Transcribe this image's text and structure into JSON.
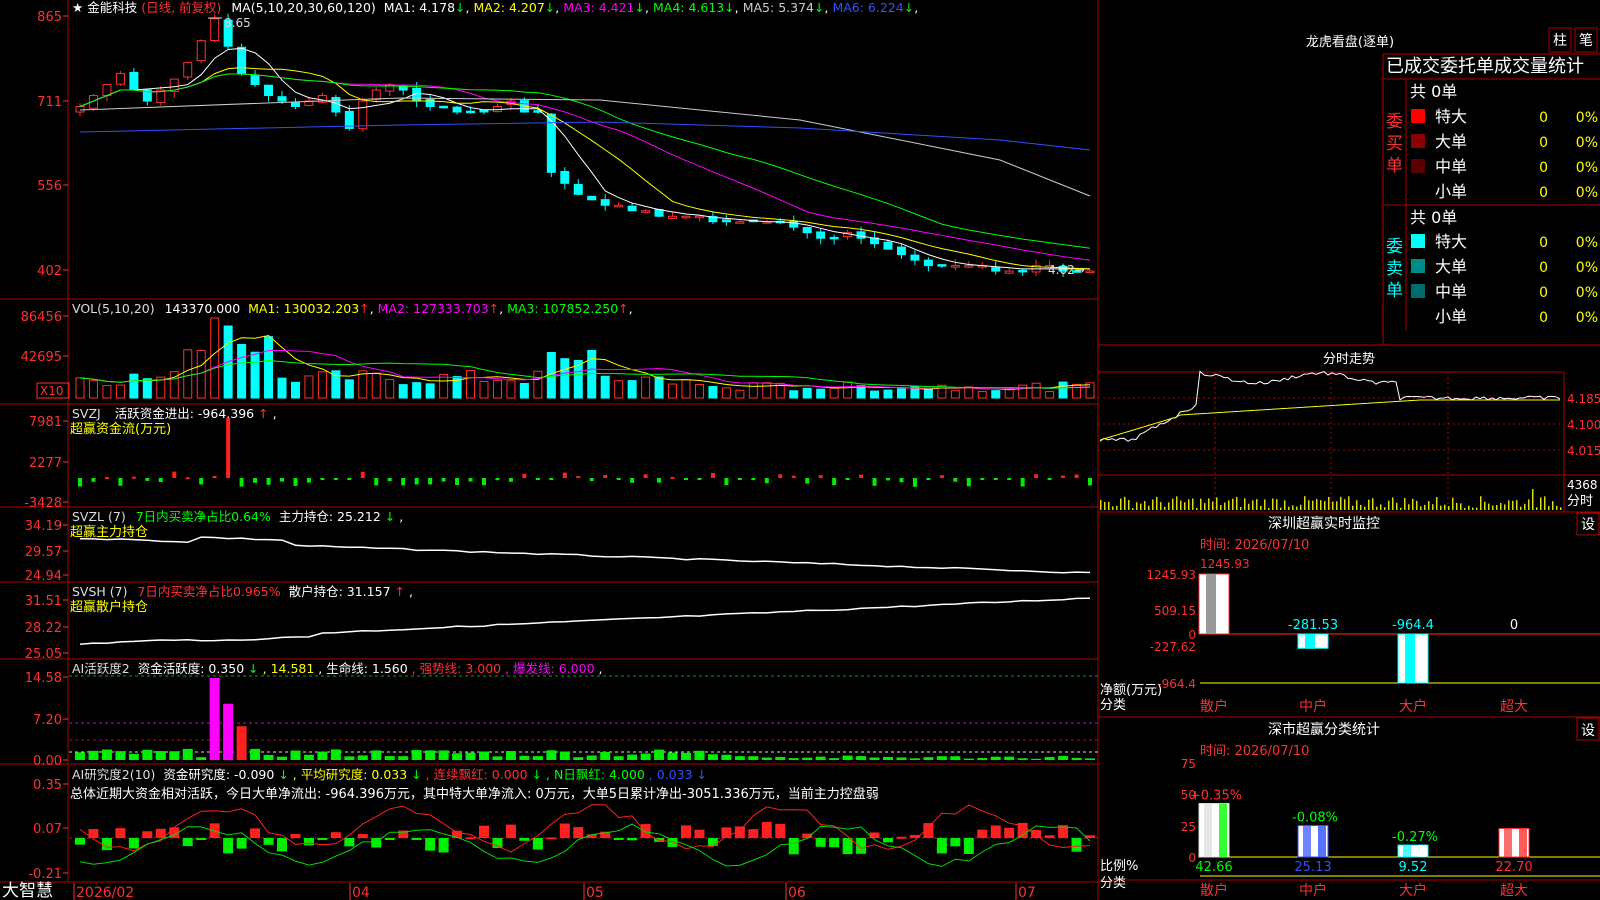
{
  "app": {
    "name": "大智慧"
  },
  "main_chart": {
    "title_star": "★",
    "stock": "金能科技",
    "mode": "(日线, 前复权)",
    "ma_prefix": "MA(5,10,20,30,60,120)",
    "ma_items": [
      {
        "label": "MA1: 4.178",
        "arrow": "↓",
        "color": "#ffffff"
      },
      {
        "label": "MA2: 4.207",
        "arrow": "↓",
        "color": "#ffff00"
      },
      {
        "label": "MA3: 4.421",
        "arrow": "↓",
        "color": "#ff00ff"
      },
      {
        "label": "MA4: 4.613",
        "arrow": "↓",
        "color": "#00ff00"
      },
      {
        "label": "MA5: 5.374",
        "arrow": "↓",
        "color": "#cccccc"
      },
      {
        "label": "MA6: 6.224",
        "arrow": "↓",
        "color": "#3050ff"
      }
    ],
    "yticks": [
      "865",
      "711",
      "556",
      "402"
    ],
    "high_label": "8.65",
    "last_label": "4.02→"
  },
  "vol_panel": {
    "title": "VOL(5,10,20)",
    "value": "143370.000",
    "items": [
      {
        "label": "MA1: 130032.203",
        "arrow": "↑",
        "color": "#ffff00"
      },
      {
        "label": "MA2: 127333.703",
        "arrow": "↑",
        "color": "#ff00ff"
      },
      {
        "label": "MA3: 107852.250",
        "arrow": "↑",
        "color": "#00ff00"
      }
    ],
    "yticks": [
      "86456",
      "42695"
    ],
    "unit": "X10"
  },
  "svzj_panel": {
    "title": "SVZJ",
    "text": "活跃资金进出: -964.396",
    "arrow": "↑",
    "tail": ",",
    "subtitle": "超赢资金流(万元)",
    "yticks": [
      "7981",
      "2277",
      "-3428"
    ]
  },
  "svzl_panel": {
    "title": "SVZL (7)",
    "text1": "7日内买卖净占比0.64%",
    "text2": "主力持仓: 25.212",
    "arrow": "↓",
    "tail": ",",
    "subtitle": "超赢主力持仓",
    "yticks": [
      "34.19",
      "29.57",
      "24.94"
    ]
  },
  "svsh_panel": {
    "title": "SVSH (7)",
    "text1": "7日内买卖净占比0.965%",
    "text2": "散户持仓: 31.157",
    "arrow": "↑",
    "tail": ",",
    "subtitle": "超赢散户持仓",
    "yticks": [
      "31.51",
      "28.22",
      "25.05"
    ]
  },
  "ai_active_panel": {
    "title": "AI活跃度2",
    "t1": "资金活跃度: 0.350",
    "a1": "↓",
    "t2": ", 14.581",
    "t3": ", 生命线: 1.560",
    "t4": ", 强势线: 3.000",
    "t5": ", 爆发线: 6.000",
    "t6": ",",
    "yticks": [
      "14.58",
      "7.20",
      "0.00"
    ]
  },
  "ai_research_panel": {
    "title": "AI研究度2(10)",
    "t1": "资金研究度: -0.090",
    "a1": "↓",
    "t2": ", 平均研究度: 0.033",
    "a2": "↓",
    "t3": ", 连续飘红: 0.000",
    "a3": "↓",
    "t4": ", N日飘红: 4.000",
    "t5": ", 0.033",
    "a5": "↓",
    "summary": "总体近期大资金相对活跃，今日大单净流出: -964.396万元，其中特大单净流入: 0万元，大单5日累计净出-3051.336万元，当前主力控盘弱",
    "yticks": [
      "0.35",
      "0.07",
      "-0.21"
    ]
  },
  "x_axis": [
    "2026/02",
    "04",
    "05",
    "06",
    "07"
  ],
  "right_panel": {
    "lhb_title": "龙虎看盘(逐单)",
    "btn_zhu": "柱",
    "btn_bi": "笔",
    "stats_title": "已成交委托单成交量统计",
    "buy_label": "委买单",
    "sell_label": "委卖单",
    "buy_total": "共 0单",
    "sell_total": "共 0单",
    "buy_rows": [
      {
        "name": "特大",
        "count": "0",
        "pct": "0%",
        "color": "#ff0000"
      },
      {
        "name": "大单",
        "count": "0",
        "pct": "0%",
        "color": "#8b0000"
      },
      {
        "name": "中单",
        "count": "0",
        "pct": "0%",
        "color": "#5a0000"
      },
      {
        "name": "小单",
        "count": "0",
        "pct": "0%",
        "color": ""
      }
    ],
    "sell_rows": [
      {
        "name": "特大",
        "count": "0",
        "pct": "0%",
        "color": "#00ffff"
      },
      {
        "name": "大单",
        "count": "0",
        "pct": "0%",
        "color": "#008b8b"
      },
      {
        "name": "中单",
        "count": "0",
        "pct": "0%",
        "color": "#006b6b"
      },
      {
        "name": "小单",
        "count": "0",
        "pct": "0%",
        "color": ""
      }
    ],
    "intraday": {
      "title": "分时走势",
      "yticks": [
        "4.185",
        "4.100",
        "4.015"
      ],
      "vol_label": "4368",
      "vol_unit": "分时"
    },
    "monitor": {
      "title": "深圳超赢实时监控",
      "btn": "设",
      "time": "时间: 2026/07/10",
      "yticks": [
        "1245.93",
        "509.15",
        "0",
        "-227.62",
        "-964.4"
      ],
      "top_label": "1245.93",
      "ylabel1": "净额(万元)",
      "ylabel2": "分类",
      "bars": [
        {
          "cat": "散户",
          "value": 1245.93,
          "label": "1245.93"
        },
        {
          "cat": "中户",
          "value": -281.53,
          "label": "-281.53"
        },
        {
          "cat": "大户",
          "value": -964.4,
          "label": "-964.4"
        },
        {
          "cat": "超大",
          "value": 0,
          "label": "0"
        }
      ]
    },
    "classify": {
      "title": "深市超赢分类统计",
      "btn": "设",
      "time": "时间: 2026/07/10",
      "yticks": [
        "75",
        "50",
        "25",
        "0"
      ],
      "ylabel1": "比例%",
      "ylabel2": "分类",
      "bars": [
        {
          "cat": "散户",
          "value": 42.66,
          "change": "+0.35%",
          "label": "42.66"
        },
        {
          "cat": "中户",
          "value": 25.13,
          "change": "-0.08%",
          "label": "25.13"
        },
        {
          "cat": "大户",
          "value": 9.52,
          "change": "-0.27%",
          "label": "9.52"
        },
        {
          "cat": "超大",
          "value": 22.7,
          "change": "",
          "label": "22.70"
        }
      ]
    }
  },
  "chart_data": [
    {
      "type": "candlestick",
      "title": "金能科技 (日线, 前复权)",
      "y_range": [
        4.02,
        8.65
      ],
      "high": 8.65,
      "last": 4.02,
      "ma_last": {
        "MA5": 4.178,
        "MA10": 4.207,
        "MA20": 4.421,
        "MA30": 4.613,
        "MA60": 5.374,
        "MA120": 6.224
      },
      "close_series": [
        7.0,
        7.2,
        7.4,
        7.6,
        7.3,
        7.1,
        7.3,
        7.5,
        7.8,
        8.2,
        8.6,
        8.1,
        7.6,
        7.4,
        7.2,
        7.1,
        7.0,
        7.1,
        7.2,
        6.9,
        6.6,
        7.1,
        7.3,
        7.4,
        7.3,
        7.1,
        7.0,
        7.0,
        6.9,
        6.9,
        6.9,
        7.0,
        7.1,
        6.9,
        6.9,
        5.8,
        5.6,
        5.4,
        5.3,
        5.2,
        5.2,
        5.1,
        5.1,
        5.0,
        5.0,
        5.0,
        5.0,
        4.9,
        4.9,
        4.9,
        4.9,
        4.9,
        4.9,
        4.8,
        4.7,
        4.6,
        4.6,
        4.7,
        4.6,
        4.5,
        4.4,
        4.3,
        4.2,
        4.1,
        4.1,
        4.1,
        4.1,
        4.1,
        4.0,
        4.0,
        4.0,
        4.1,
        4.1,
        4.0,
        4.0,
        4.0
      ]
    },
    {
      "type": "bar",
      "title": "VOL(5,10,20)",
      "unit": "X10",
      "last": 143370.0,
      "ma": {
        "MA1": 130032.203,
        "MA2": 127333.703,
        "MA3": 107852.25
      },
      "y_max": 86456
    },
    {
      "type": "bar",
      "title": "深圳超赢实时监控",
      "categories": [
        "散户",
        "中户",
        "大户",
        "超大"
      ],
      "values": [
        1245.93,
        -281.53,
        -964.4,
        0
      ],
      "ylabel": "净额(万元)",
      "ylim": [
        -964.4,
        1245.93
      ]
    },
    {
      "type": "bar",
      "title": "深市超赢分类统计",
      "categories": [
        "散户",
        "中户",
        "大户",
        "超大"
      ],
      "values": [
        42.66,
        25.13,
        9.52,
        22.7
      ],
      "changes": [
        "+0.35%",
        "-0.08%",
        "-0.27%",
        ""
      ],
      "ylabel": "比例%",
      "ylim": [
        0,
        75
      ]
    }
  ]
}
